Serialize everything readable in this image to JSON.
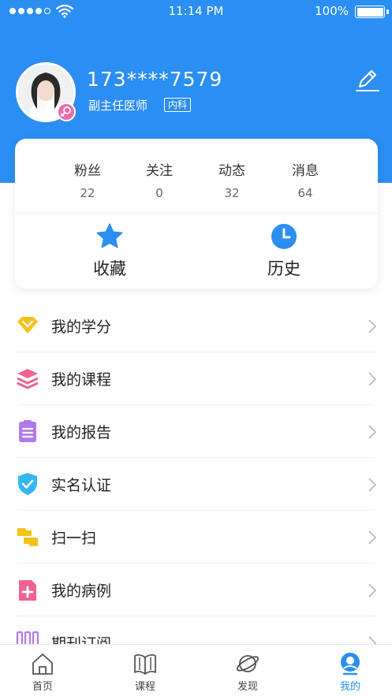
{
  "status_bar": {
    "time": "11:14 PM",
    "battery": "100%"
  },
  "profile": {
    "username": "173****7579",
    "job_title": "副主任医师",
    "department": "内科"
  },
  "stats": [
    {
      "label": "粉丝",
      "value": "22"
    },
    {
      "label": "关注",
      "value": "0"
    },
    {
      "label": "动态",
      "value": "32"
    },
    {
      "label": "消息",
      "value": "64"
    }
  ],
  "shortcuts": [
    {
      "label": "收藏",
      "icon": "star-icon"
    },
    {
      "label": "历史",
      "icon": "clock-icon"
    }
  ],
  "menu": [
    {
      "label": "我的学分",
      "icon": "diamond-icon",
      "color": "#f5c21c"
    },
    {
      "label": "我的课程",
      "icon": "layers-icon",
      "color": "#f0628f"
    },
    {
      "label": "我的报告",
      "icon": "clipboard-icon",
      "color": "#b278ea"
    },
    {
      "label": "实名认证",
      "icon": "shield-check-icon",
      "color": "#35b6f2"
    },
    {
      "label": "扫一扫",
      "icon": "scan-icon",
      "color": "#f5c21c"
    },
    {
      "label": "我的病例",
      "icon": "medical-file-icon",
      "color": "#f0628f"
    },
    {
      "label": "期刊订阅",
      "icon": "journal-icon",
      "color": "#b278ea"
    }
  ],
  "bottom_nav": [
    {
      "label": "首页",
      "icon": "home-icon"
    },
    {
      "label": "课程",
      "icon": "book-icon"
    },
    {
      "label": "发现",
      "icon": "planet-icon"
    },
    {
      "label": "我的",
      "icon": "user-icon",
      "active": true
    }
  ],
  "colors": {
    "primary": "#2b8ef2",
    "female_badge": "#ee6aa7"
  }
}
